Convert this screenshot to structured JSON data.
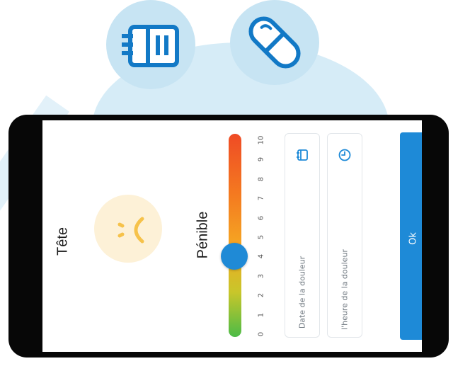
{
  "header_icons": [
    {
      "name": "calendar-icon",
      "interactable": false
    },
    {
      "name": "pill-icon",
      "interactable": false
    }
  ],
  "screen": {
    "location_label": "Tête",
    "face_icon": "sad-face-icon",
    "intensity_label": "Pénible",
    "slider": {
      "min": 0,
      "max": 10,
      "value": 4,
      "ticks": [
        "0",
        "1",
        "2",
        "3",
        "4",
        "5",
        "6",
        "7",
        "8",
        "9",
        "10"
      ]
    },
    "date_field": {
      "placeholder": "Date de la douleur",
      "icon": "calendar-icon"
    },
    "time_field": {
      "placeholder": "l'heure de la douleur",
      "icon": "clock-icon"
    },
    "ok_button": {
      "label": "Ok"
    }
  },
  "colors": {
    "accent": "#1e8ad7",
    "background_bubble": "#d6ecf7",
    "face_background": "#fdf1d7",
    "face_stroke": "#f6c24a",
    "slider_gradient": [
      "#ef4b25",
      "#f5a623",
      "#4cbb47"
    ]
  }
}
